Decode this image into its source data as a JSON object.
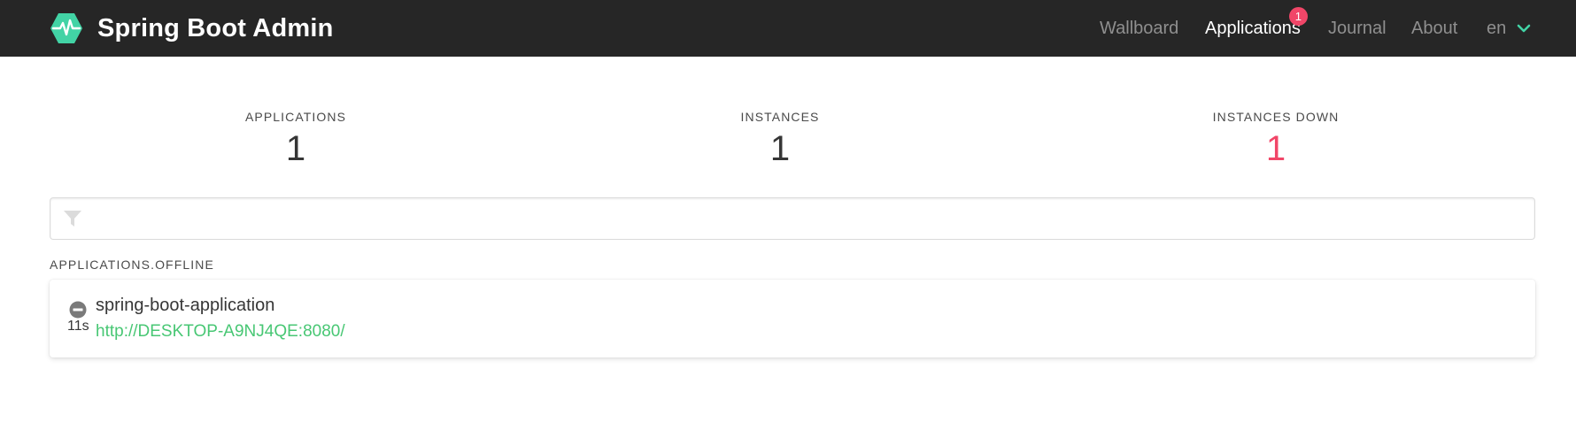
{
  "app": {
    "title": "Spring Boot Admin",
    "logo_icon": "heartbeat-hexagon-icon",
    "brand_color": "#42d3a5"
  },
  "nav": {
    "items": [
      {
        "label": "Wallboard",
        "active": false
      },
      {
        "label": "Applications",
        "active": true,
        "badge": "1"
      },
      {
        "label": "Journal",
        "active": false
      },
      {
        "label": "About",
        "active": false
      }
    ],
    "language": {
      "label": "en",
      "icon": "chevron-down-icon"
    }
  },
  "stats": {
    "applications": {
      "label": "APPLICATIONS",
      "value": "1"
    },
    "instances": {
      "label": "INSTANCES",
      "value": "1"
    },
    "instances_down": {
      "label": "INSTANCES DOWN",
      "value": "1",
      "color": "#f14668"
    }
  },
  "filter": {
    "icon": "filter-icon",
    "value": "",
    "placeholder": ""
  },
  "groups": [
    {
      "title": "APPLICATIONS.OFFLINE",
      "applications": [
        {
          "name": "spring-boot-application",
          "url": "http://DESKTOP-A9NJ4QE:8080/",
          "status_icon": "minus-circle-icon",
          "status_age": "11s"
        }
      ]
    }
  ],
  "colors": {
    "navbar": "#262626",
    "accent": "#42d3a5",
    "link": "#48c774",
    "danger": "#f14668"
  }
}
